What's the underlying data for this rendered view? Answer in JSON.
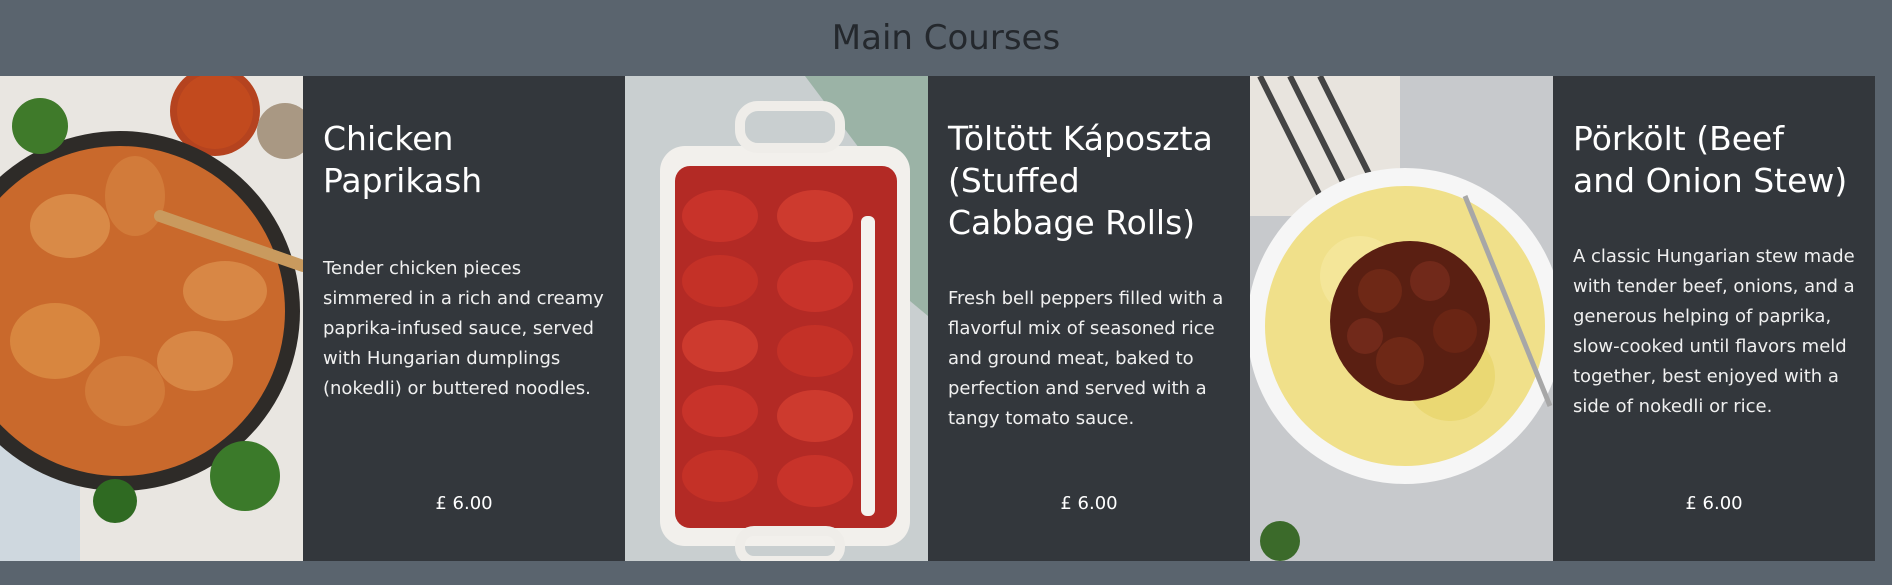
{
  "page": {
    "title": "Main Courses"
  },
  "dishes": [
    {
      "name": "Chicken Paprikash",
      "description": "Tender chicken pieces simmered in a rich and creamy paprika-infused sauce, served with Hungarian dumplings (nokedli) or buttered noodles.",
      "price": "£ 6.00",
      "image": "chicken-paprikash-photo"
    },
    {
      "name": "Töltött Káposzta (Stuffed Cabbage Rolls)",
      "description": "Fresh bell peppers filled with a flavorful mix of seasoned rice and ground meat, baked to perfection and served with a tangy tomato sauce.",
      "price": "£ 6.00",
      "image": "stuffed-cabbage-photo"
    },
    {
      "name": "Pörkölt (Beef and Onion Stew)",
      "description": "A classic Hungarian stew made with tender beef, onions, and a generous helping of paprika, slow-cooked until flavors meld together, best enjoyed with a side of nokedli or rice.",
      "price": "£ 6.00",
      "image": "porkolt-photo"
    }
  ]
}
